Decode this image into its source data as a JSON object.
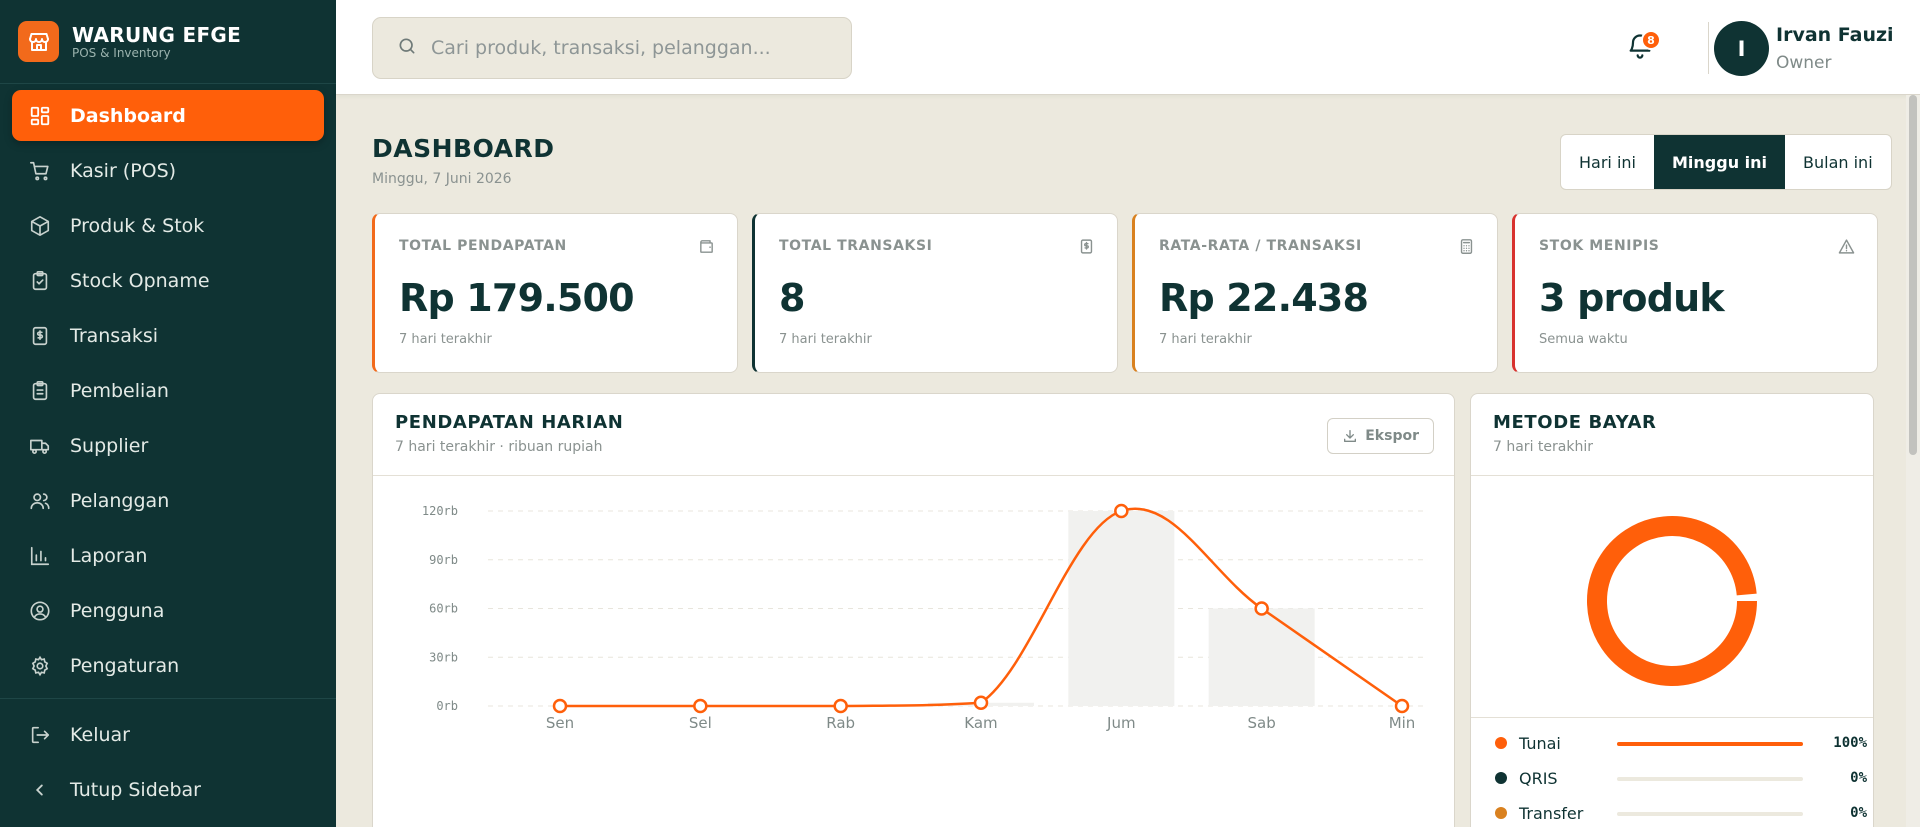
{
  "brand": {
    "name": "WARUNG EFGE",
    "subtitle": "POS & Inventory"
  },
  "nav": [
    {
      "label": "Dashboard",
      "icon": "dashboard-icon",
      "active": true
    },
    {
      "label": "Kasir (POS)",
      "icon": "cart-icon"
    },
    {
      "label": "Produk & Stok",
      "icon": "box-icon"
    },
    {
      "label": "Stock Opname",
      "icon": "clipboard-check-icon"
    },
    {
      "label": "Transaksi",
      "icon": "receipt-icon"
    },
    {
      "label": "Pembelian",
      "icon": "clipboard-icon"
    },
    {
      "label": "Supplier",
      "icon": "truck-icon"
    },
    {
      "label": "Pelanggan",
      "icon": "users-icon"
    },
    {
      "label": "Laporan",
      "icon": "bar-chart-icon"
    },
    {
      "label": "Pengguna",
      "icon": "user-circle-icon"
    },
    {
      "label": "Pengaturan",
      "icon": "gear-icon"
    }
  ],
  "nav_bottom": [
    {
      "label": "Keluar",
      "icon": "logout-icon"
    },
    {
      "label": "Tutup Sidebar",
      "icon": "chevron-left-icon"
    }
  ],
  "search": {
    "placeholder": "Cari produk, transaksi, pelanggan..."
  },
  "notifications": {
    "count": "8"
  },
  "user": {
    "initial": "I",
    "name": "Irvan Fauzi",
    "role": "Owner"
  },
  "page": {
    "title": "DASHBOARD",
    "date": "Minggu, 7 Juni 2026"
  },
  "range": {
    "options": [
      "Hari ini",
      "Minggu ini",
      "Bulan ini"
    ],
    "active": 1
  },
  "kpis": [
    {
      "label": "TOTAL PENDAPATAN",
      "value": "Rp 179.500",
      "sub": "7 hari terakhir",
      "accent": "#F26A1B",
      "icon": "wallet-icon"
    },
    {
      "label": "TOTAL TRANSAKSI",
      "value": "8",
      "sub": "7 hari terakhir",
      "accent": "#0F3333",
      "icon": "receipt-icon"
    },
    {
      "label": "RATA-RATA / TRANSAKSI",
      "value": "Rp 22.438",
      "sub": "7 hari terakhir",
      "accent": "#D9811F",
      "icon": "calculator-icon"
    },
    {
      "label": "STOK MENIPIS",
      "value": "3 produk",
      "sub": "Semua waktu",
      "accent": "#D8322E",
      "icon": "warning-icon"
    }
  ],
  "revenue_card": {
    "title": "PENDAPATAN HARIAN",
    "subtitle": "7 hari terakhir · ribuan rupiah",
    "export_label": "Ekspor"
  },
  "payment_card": {
    "title": "METODE BAYAR",
    "subtitle": "7 hari terakhir"
  },
  "chart_data": [
    {
      "type": "line",
      "categories": [
        "Sen",
        "Sel",
        "Rab",
        "Kam",
        "Jum",
        "Sab",
        "Min"
      ],
      "series": [
        {
          "values": [
            0,
            0,
            0,
            2,
            120,
            60,
            0
          ],
          "color": "#FF5F0A"
        }
      ],
      "bars": [
        0,
        0,
        0,
        2,
        120,
        60,
        0
      ],
      "y_ticks": [
        "0rb",
        "30rb",
        "60rb",
        "90rb",
        "120rb"
      ],
      "y_tick_values": [
        0,
        30,
        60,
        90,
        120
      ],
      "ylim": [
        0,
        120
      ],
      "grid": true
    },
    {
      "type": "pie",
      "categories": [
        "Tunai",
        "QRIS",
        "Transfer"
      ],
      "values": [
        100,
        0,
        0
      ],
      "labels": [
        "100%",
        "0%",
        "0%"
      ],
      "colors": [
        "#FF5F0A",
        "#0F3333",
        "#D9811F"
      ]
    }
  ]
}
